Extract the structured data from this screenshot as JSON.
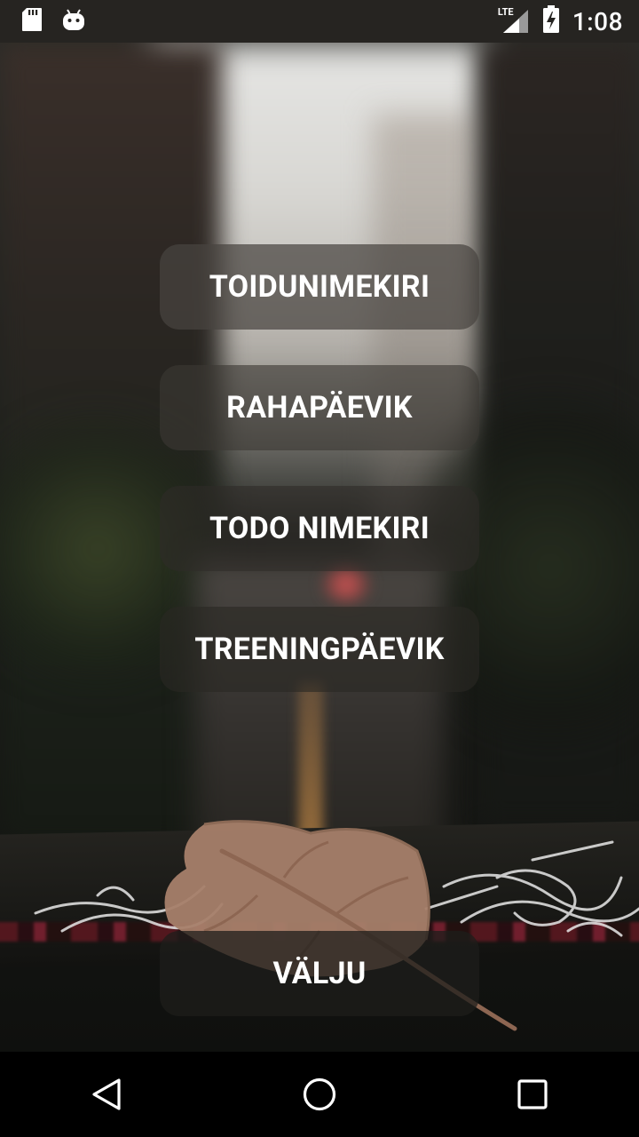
{
  "status_bar": {
    "time": "1:08",
    "network": "LTE",
    "icons": [
      "sd-card-icon",
      "android-debug-icon",
      "signal-icon",
      "battery-charging-icon"
    ]
  },
  "menu": {
    "buttons": [
      {
        "label": "TOIDUNIMEKIRI"
      },
      {
        "label": "RAHAPÄEVIK"
      },
      {
        "label": "TODO NIMEKIRI"
      },
      {
        "label": "TREENINGPÄEVIK"
      }
    ],
    "exit_label": "VÄLJU"
  },
  "nav_bar": {
    "icons": [
      "back-icon",
      "home-icon",
      "recents-icon"
    ]
  },
  "colors": {
    "button_text": "#ffffff",
    "status_bar_bg": "#262421",
    "nav_bar_bg": "#000000"
  }
}
